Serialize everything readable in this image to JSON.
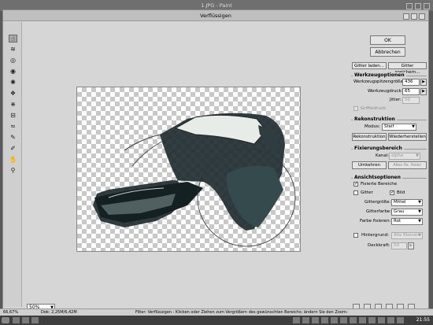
{
  "app_title": "1.JPG - Paint",
  "dialog": {
    "title": "Verflüssigen"
  },
  "buttons": {
    "ok": "OK",
    "cancel": "Abbrechen",
    "load_mesh": "Gitter laden...",
    "save_mesh": "Gitter speichern..."
  },
  "werkzeug": {
    "heading": "Werkzeugoptionen",
    "brush_size_label": "Werkzeugspitzengröße:",
    "brush_size": "436",
    "brush_pressure_label": "Werkzeugdruck:",
    "brush_pressure": "65",
    "jitter_label": "Jitter:",
    "jitter": "50",
    "pen_pressure_label": "Griffeldruck"
  },
  "rekonstruktion": {
    "heading": "Rekonstruktion",
    "mode_label": "Modus:",
    "mode": "Steif",
    "reconstruct_button": "Rekonstruktion",
    "restore_button": "Wiederherstellen"
  },
  "fixierung": {
    "heading": "Fixierungsbereich",
    "channel_label": "Kanal:",
    "channel": "alpha",
    "invert_button": "Umkehren",
    "freeze_all_button": "Alles fix. fixier."
  },
  "ansicht": {
    "heading": "Ansichtsoptionen",
    "frozen_areas_label": "Fixierte Bereiche",
    "mesh_label": "Gitter",
    "image_label": "Bild",
    "mesh_size_label": "Gittergröße:",
    "mesh_size": "Mittel",
    "mesh_color_label": "Gitterfarbe:",
    "mesh_color": "Grau",
    "freeze_color_label": "Farbe fixieren:",
    "freeze_color": "Rot",
    "backdrop_label": "Hintergrund:",
    "backdrop": "Alle Ebenen",
    "opacity_label": "Deckkraft:",
    "opacity": "50"
  },
  "zoom": "50%",
  "status": {
    "left_size": "66,67%",
    "doc": "Dok: 2,25M/6,42M",
    "hint": "Filter: Verflüssigen - Klicken oder Ziehen zum Vergrößern des gewünschten Bereichs; ändern Sie den Zoom-Stand ..."
  },
  "clock": "21:55",
  "tools": [
    "forward-warp-tool",
    "reconstruct-tool",
    "twirl-cw-tool",
    "twirl-ccw-tool",
    "pucker-tool",
    "bloat-tool",
    "shift-pixels-tool",
    "reflection-tool",
    "turbulence-tool",
    "freeze-mask-tool",
    "thaw-mask-tool",
    "hand-tool",
    "zoom-tool"
  ]
}
